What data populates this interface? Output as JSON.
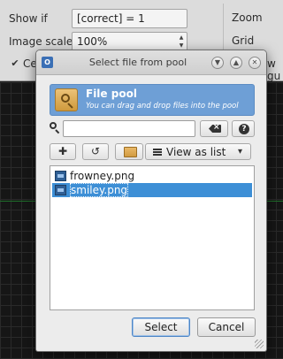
{
  "background": {
    "show_if_label": "Show if",
    "show_if_value": "[correct] = 1",
    "image_scale_label": "Image scale",
    "image_scale_value": "100%",
    "center_label": "Ce",
    "zoom_label": "Zoom",
    "grid_label": "Grid",
    "show_gui_label": "w gu"
  },
  "dialog": {
    "title": "Select file from pool",
    "window_buttons": [
      "chevron-down-icon",
      "chevron-up-icon",
      "close-icon"
    ],
    "header": {
      "title": "File pool",
      "subtitle": "You can drag and drop files into the pool"
    },
    "search": {
      "value": "",
      "placeholder": ""
    },
    "view_select": {
      "selected": "View as list"
    },
    "files": [
      {
        "name": "frowney.png",
        "selected": false
      },
      {
        "name": "smiley.png",
        "selected": true
      }
    ],
    "buttons": {
      "select": "Select",
      "cancel": "Cancel"
    }
  },
  "colors": {
    "header_bg": "#6e9fd6",
    "selection": "#3d8fd6",
    "dialog_bg": "#ececec"
  }
}
